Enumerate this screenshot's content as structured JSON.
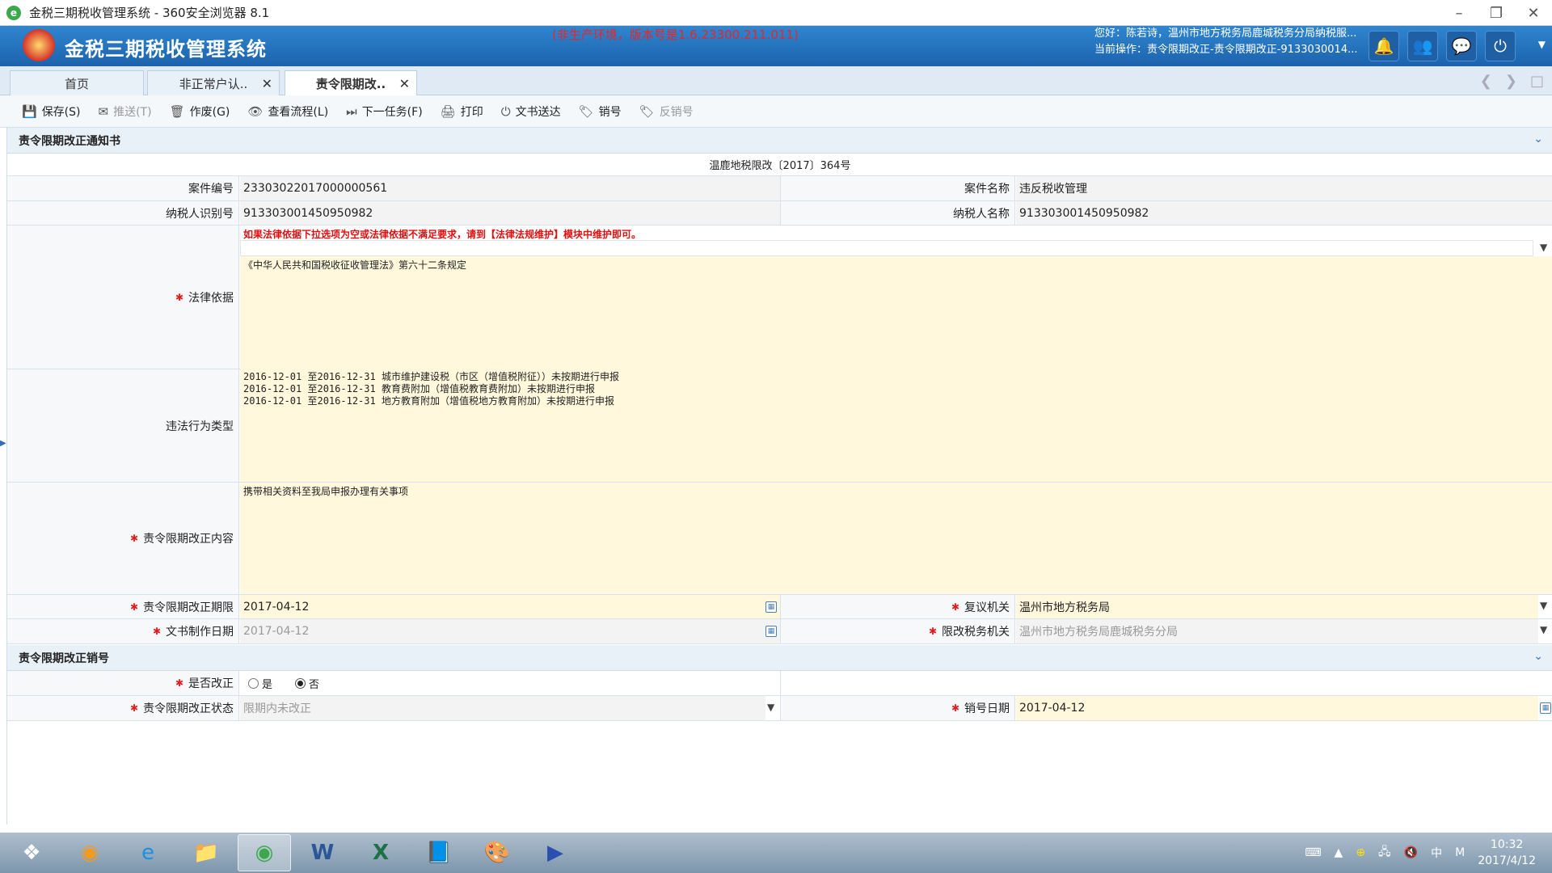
{
  "window": {
    "title": "金税三期税收管理系统 - 360安全浏览器 8.1",
    "app_icon": "e-browser-icon",
    "controls": [
      "minimize-icon",
      "restore-icon",
      "close-icon"
    ]
  },
  "header": {
    "system_title": "金税三期税收管理系统",
    "env_notice": "(非生产环境，版本号是1.6.23300.211.011)",
    "greeting": "您好：陈若诗，温州市地方税务局鹿城税务分局纳税服...",
    "current_op": "当前操作：责令限期改正-责令限期改正-9133030014...",
    "icons": [
      "bell-icon",
      "users-icon",
      "chat-icon",
      "power-icon"
    ]
  },
  "tabs": [
    {
      "label": "首页",
      "closable": false,
      "active": false
    },
    {
      "label": "非正常户认..",
      "closable": true,
      "active": false
    },
    {
      "label": "责令限期改..",
      "closable": true,
      "active": true
    }
  ],
  "toolbar": [
    {
      "label": "保存(S)",
      "icon": "save-icon",
      "disabled": false
    },
    {
      "label": "推送(T)",
      "icon": "mail-icon",
      "disabled": true
    },
    {
      "label": "作废(G)",
      "icon": "trash-icon",
      "disabled": false
    },
    {
      "label": "查看流程(L)",
      "icon": "eye-icon",
      "disabled": false
    },
    {
      "label": "下一任务(F)",
      "icon": "next-icon",
      "disabled": false
    },
    {
      "label": "打印",
      "icon": "print-icon",
      "disabled": false
    },
    {
      "label": "文书送达",
      "icon": "power-icon",
      "disabled": false
    },
    {
      "label": "销号",
      "icon": "tag-icon",
      "disabled": false
    },
    {
      "label": "反销号",
      "icon": "tag-icon",
      "disabled": true
    }
  ],
  "notice": {
    "section_title": "责令限期改正通知书",
    "doc_number": "温鹿地税限改〔2017〕364号",
    "case_no_label": "案件编号",
    "case_no": "23303022017000000561",
    "case_name_label": "案件名称",
    "case_name": "违反税收管理",
    "taxpayer_id_label": "纳税人识别号",
    "taxpayer_id": "913303001450950982",
    "taxpayer_name_label": "纳税人名称",
    "taxpayer_name": "913303001450950982",
    "legal_basis_label": "法律依据",
    "legal_basis_warning": "如果法律依据下拉选项为空或法律依据不满足要求，请到【法律法规维护】模块中维护即可。",
    "legal_basis_select": "",
    "legal_basis_text": "《中华人民共和国税收征收管理法》第六十二条规定",
    "violation_label": "违法行为类型",
    "violations": [
      "2016-12-01 至2016-12-31 城市维护建设税（市区（增值税附征））未按期进行申报",
      "2016-12-01 至2016-12-31 教育费附加（增值税教育费附加）未按期进行申报",
      "2016-12-01 至2016-12-31 地方教育附加（增值税地方教育附加）未按期进行申报"
    ],
    "content_label": "责令限期改正内容",
    "content_text": "携带相关资料至我局申报办理有关事项",
    "deadline_label": "责令限期改正期限",
    "deadline": "2017-04-12",
    "review_org_label": "复议机关",
    "review_org": "温州市地方税务局",
    "doc_date_label": "文书制作日期",
    "doc_date": "2017-04-12",
    "tax_org_label": "限改税务机关",
    "tax_org": "温州市地方税务局鹿城税务分局"
  },
  "cancel": {
    "section_title": "责令限期改正销号",
    "corrected_label": "是否改正",
    "opt_yes": "是",
    "opt_no": "否",
    "selected": "否",
    "status_label": "责令限期改正状态",
    "status": "限期内未改正",
    "cancel_date_label": "销号日期",
    "cancel_date": "2017-04-12"
  },
  "taskbar": {
    "apps": [
      "windows-start-icon",
      "player-icon",
      "ie-icon",
      "folder-icon",
      "360-browser-icon",
      "word-icon",
      "excel-icon",
      "notebook-icon",
      "paint-icon",
      "media-icon"
    ],
    "tray_ime": "中",
    "tray_m": "M",
    "time": "10:32",
    "date": "2017/4/12"
  }
}
